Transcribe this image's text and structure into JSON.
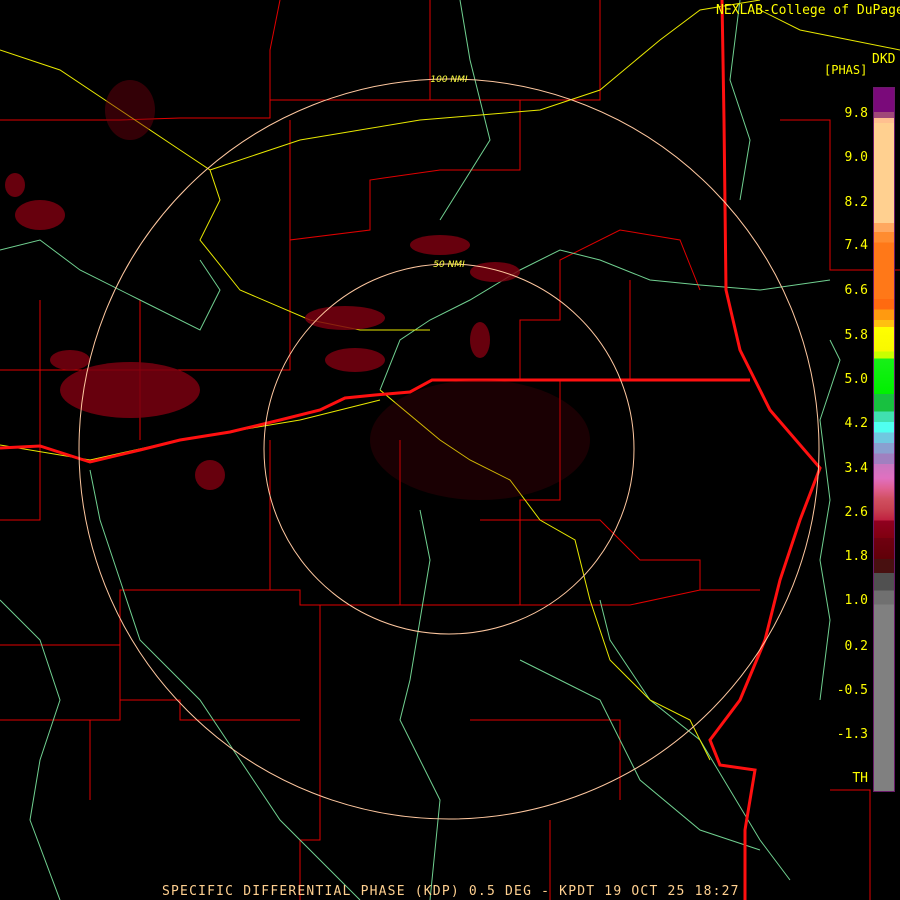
{
  "header": {
    "credit": "NEXLAB-College of DuPage",
    "units": "DKD",
    "product_code": "[PHAS]"
  },
  "ranges": {
    "outer": "100 NMI",
    "inner": "50 NMI"
  },
  "legend": {
    "ticks": [
      "9.8",
      "9.0",
      "8.2",
      "7.4",
      "6.6",
      "5.8",
      "5.0",
      "4.2",
      "3.4",
      "2.6",
      "1.8",
      "1.0",
      "0.2",
      "-0.5",
      "-1.3",
      "TH"
    ]
  },
  "footer": {
    "title": "SPECIFIC DIFFERENTIAL PHASE (KDP) 0.5 DEG - KPDT 19 OCT 25 18:27"
  }
}
